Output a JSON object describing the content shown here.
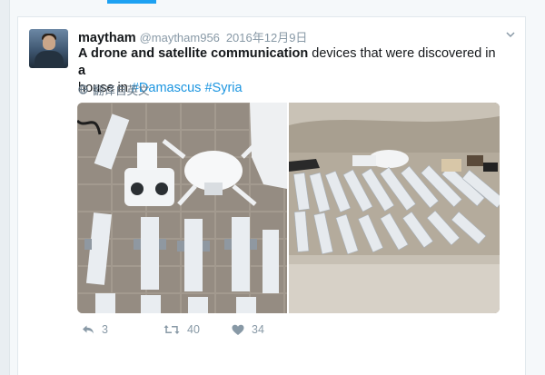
{
  "tweet": {
    "author_name": "maytham",
    "handle": "@maytham956",
    "timestamp": "2016年12月9日",
    "text_bold_1": "A drone and satellite communication",
    "text_part_2": " devices that were discovered in ",
    "text_bold_2": "a",
    "text_part_3": " house in ",
    "hashtag_1": "#Damascus",
    "hashtag_2": "#Syria",
    "translate_label": "翻译自英文"
  },
  "actions": {
    "reply_count": "3",
    "retweet_count": "40",
    "like_count": "34"
  },
  "icons": {
    "reply": "reply-icon",
    "retweet": "retweet-icon",
    "like": "heart-icon",
    "caret": "chevron-down-icon",
    "translate": "globe-icon"
  },
  "colors": {
    "accent": "#1da1f2",
    "link": "#1b95e0",
    "muted": "#8899a6"
  }
}
